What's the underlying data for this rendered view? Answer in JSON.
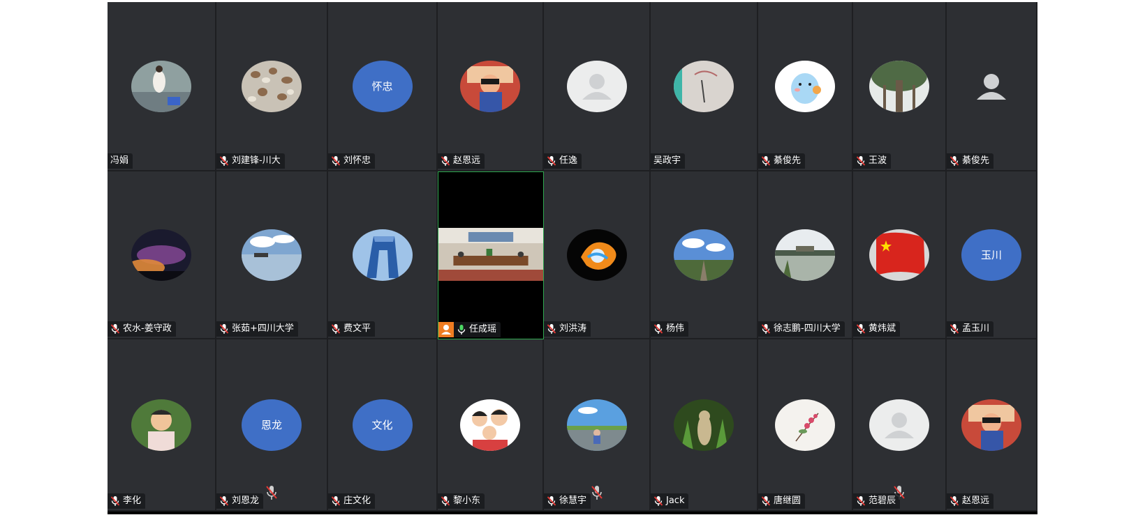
{
  "colors": {
    "tile_bg": "#2d2f33",
    "avatar_text_bg": "#3f6fc6",
    "active_speaker_border": "#2fa84f",
    "muted_red": "#e53935",
    "host_badge": "#ef7d22"
  },
  "participants": [
    {
      "name": "冯娟",
      "avatar_label": "",
      "mic": "none"
    },
    {
      "name": "刘建锋-川大",
      "avatar_label": "",
      "mic": "muted"
    },
    {
      "name": "刘怀忠",
      "avatar_label": "怀忠",
      "mic": "muted"
    },
    {
      "name": "赵恩远",
      "avatar_label": "",
      "mic": "muted"
    },
    {
      "name": "任逸",
      "avatar_label": "",
      "mic": "muted"
    },
    {
      "name": "吴政宇",
      "avatar_label": "",
      "mic": "none"
    },
    {
      "name": "綦俊先",
      "avatar_label": "",
      "mic": "muted"
    },
    {
      "name": "王波",
      "avatar_label": "",
      "mic": "muted"
    },
    {
      "name": "綦俊先",
      "avatar_label": "",
      "mic": "muted"
    },
    {
      "name": "农水-姜守政",
      "avatar_label": "",
      "mic": "muted"
    },
    {
      "name": "张茹+四川大学",
      "avatar_label": "",
      "mic": "muted"
    },
    {
      "name": "费文平",
      "avatar_label": "",
      "mic": "muted"
    },
    {
      "name": "任成瑶",
      "avatar_label": "",
      "mic": "on"
    },
    {
      "name": "刘洪涛",
      "avatar_label": "",
      "mic": "muted"
    },
    {
      "name": "杨伟",
      "avatar_label": "",
      "mic": "muted"
    },
    {
      "name": "徐志鹏-四川大学",
      "avatar_label": "",
      "mic": "muted"
    },
    {
      "name": "黄炜斌",
      "avatar_label": "",
      "mic": "muted"
    },
    {
      "name": "孟玉川",
      "avatar_label": "玉川",
      "mic": "muted"
    },
    {
      "name": "李化",
      "avatar_label": "",
      "mic": "muted"
    },
    {
      "name": "刘恩龙",
      "avatar_label": "恩龙",
      "mic": "muted"
    },
    {
      "name": "庄文化",
      "avatar_label": "文化",
      "mic": "muted"
    },
    {
      "name": "黎小东",
      "avatar_label": "",
      "mic": "muted"
    },
    {
      "name": "徐慧宇",
      "avatar_label": "",
      "mic": "muted"
    },
    {
      "name": "Jack",
      "avatar_label": "",
      "mic": "muted"
    },
    {
      "name": "唐继圆",
      "avatar_label": "",
      "mic": "muted"
    },
    {
      "name": "范碧辰",
      "avatar_label": "",
      "mic": "muted"
    },
    {
      "name": "赵恩远",
      "avatar_label": "",
      "mic": "muted"
    }
  ],
  "icons": {
    "muted_mic": "muted-mic-icon",
    "active_mic": "microphone-icon",
    "host": "person-icon",
    "default_avatar": "default-user-icon"
  }
}
